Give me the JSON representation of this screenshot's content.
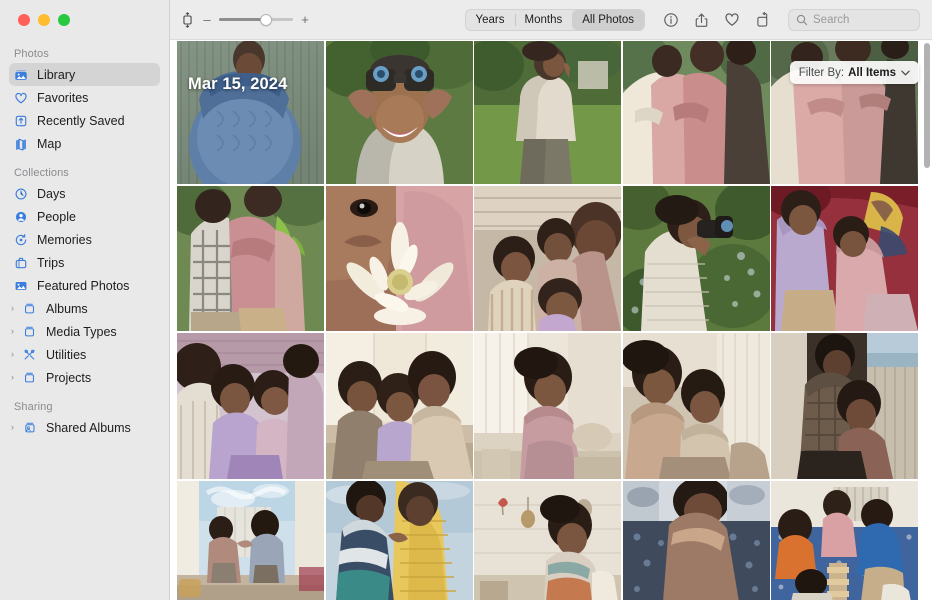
{
  "window": {
    "title": "Photos",
    "traffic_lights": {
      "close": "close",
      "minimize": "minimize",
      "zoom": "zoom"
    }
  },
  "toolbar": {
    "zoom_out_label": "–",
    "zoom_in_label": "+",
    "zoom_slider_value": 60,
    "view_modes": [
      {
        "label": "Years",
        "active": false
      },
      {
        "label": "Months",
        "active": false
      },
      {
        "label": "All Photos",
        "active": true
      }
    ],
    "icons": [
      {
        "name": "info-icon",
        "glyph": "info"
      },
      {
        "name": "share-icon",
        "glyph": "share"
      },
      {
        "name": "favorite-icon",
        "glyph": "heart"
      },
      {
        "name": "rotate-icon",
        "glyph": "rotate"
      }
    ],
    "search": {
      "placeholder": "Search",
      "value": ""
    }
  },
  "sidebar": {
    "sections": [
      {
        "title": "Photos",
        "items": [
          {
            "label": "Library",
            "icon": "library-icon",
            "selected": true,
            "expandable": false
          },
          {
            "label": "Favorites",
            "icon": "heart-icon",
            "selected": false,
            "expandable": false
          },
          {
            "label": "Recently Saved",
            "icon": "recently-saved-icon",
            "selected": false,
            "expandable": false
          },
          {
            "label": "Map",
            "icon": "map-icon",
            "selected": false,
            "expandable": false
          }
        ]
      },
      {
        "title": "Collections",
        "items": [
          {
            "label": "Days",
            "icon": "clock-icon",
            "selected": false,
            "expandable": false
          },
          {
            "label": "People",
            "icon": "person-icon",
            "selected": false,
            "expandable": false
          },
          {
            "label": "Memories",
            "icon": "memories-icon",
            "selected": false,
            "expandable": false
          },
          {
            "label": "Trips",
            "icon": "trips-icon",
            "selected": false,
            "expandable": false
          },
          {
            "label": "Featured Photos",
            "icon": "featured-photos-icon",
            "selected": false,
            "expandable": false
          },
          {
            "label": "Albums",
            "icon": "album-icon",
            "selected": false,
            "expandable": true
          },
          {
            "label": "Media Types",
            "icon": "album-icon",
            "selected": false,
            "expandable": true
          },
          {
            "label": "Utilities",
            "icon": "utilities-icon",
            "selected": false,
            "expandable": true
          },
          {
            "label": "Projects",
            "icon": "album-icon",
            "selected": false,
            "expandable": true
          }
        ]
      },
      {
        "title": "Sharing",
        "items": [
          {
            "label": "Shared Albums",
            "icon": "shared-album-icon",
            "selected": false,
            "expandable": true
          }
        ]
      }
    ],
    "disclosure_glyph": "›"
  },
  "content": {
    "date_label": "Mar 15, 2024",
    "filter": {
      "label": "Filter By:",
      "value": "All Items",
      "chevron": "⌄"
    },
    "grid": {
      "columns": 5,
      "rows": [
        {
          "row": 1,
          "cells": [
            {
              "alt": "Person in blue knit sweater against striped backdrop",
              "c1": "#5d7fa8",
              "c2": "#3f5f8a",
              "c3": "#7e9585",
              "c4": "#2b3a4d"
            },
            {
              "alt": "Smiling person looking through binoculars",
              "c1": "#8a6750",
              "c2": "#6d8a55",
              "c3": "#c9ad96",
              "c4": "#3c4a33"
            },
            {
              "alt": "Child in cream sweater standing on grass",
              "c1": "#9aa986",
              "c2": "#5b7442",
              "c3": "#ded6c6",
              "c4": "#7b8f63"
            },
            {
              "alt": "Two children in pink embracing outdoors",
              "c1": "#d9a7a4",
              "c2": "#b77b7c",
              "c3": "#8c6a62",
              "c4": "#e3c4bd"
            },
            {
              "alt": "Children hugging in pink sweatshirts",
              "c1": "#dba9a6",
              "c2": "#c08b88",
              "c3": "#6a7a5c",
              "c4": "#e8cdc6"
            }
          ]
        },
        {
          "row": 2,
          "cells": [
            {
              "alt": "Two children embracing wearing plaid and pink",
              "c1": "#9aab84",
              "c2": "#c98f92",
              "c3": "#d9d5cd",
              "c4": "#5c6f49"
            },
            {
              "alt": "Close-up of white dahlia flower held by person",
              "c1": "#c98f92",
              "c2": "#f0ead9",
              "c3": "#d7b9ae",
              "c4": "#b8a07f"
            },
            {
              "alt": "Family of five lying together smiling",
              "c1": "#b08d79",
              "c2": "#6d5244",
              "c3": "#d9c7b4",
              "c4": "#4b3a30"
            },
            {
              "alt": "Child using binoculars in a garden",
              "c1": "#7d9159",
              "c2": "#4d6236",
              "c3": "#cfd2c0",
              "c4": "#2f3d24"
            },
            {
              "alt": "Two children resting on a red velvet sofa",
              "c1": "#8e2733",
              "c2": "#b9a9cf",
              "c3": "#c7ad8a",
              "c4": "#6b1b24"
            }
          ]
        },
        {
          "row": 3,
          "cells": [
            {
              "alt": "Family cuddling on a bed in lavender clothing",
              "c1": "#c0a0b2",
              "c2": "#9a7f94",
              "c3": "#d8cfd6",
              "c4": "#7a6070"
            },
            {
              "alt": "Parent and children sitting in bright living room",
              "c1": "#d6c7b2",
              "c2": "#8e7a68",
              "c3": "#efe6d6",
              "c4": "#5d4d40"
            },
            {
              "alt": "Child on a bed in sunlit bedroom",
              "c1": "#e5ddd0",
              "c2": "#a08f7c",
              "c3": "#f2ece2",
              "c4": "#6e5f52"
            },
            {
              "alt": "Two siblings leaning together on sofa",
              "c1": "#c8a98f",
              "c2": "#8a6f5c",
              "c3": "#ded2c1",
              "c4": "#4f4036"
            },
            {
              "alt": "Adult embracing child by a window",
              "c1": "#3a3129",
              "c2": "#6d5c4c",
              "c3": "#b7a995",
              "c4": "#1f1a16"
            }
          ]
        },
        {
          "row": 4,
          "cells": [
            {
              "alt": "Two children playing clapping game by window",
              "c1": "#dfe3e6",
              "c2": "#9fa6ad",
              "c3": "#c3b4a4",
              "c4": "#6a7078"
            },
            {
              "alt": "Child and adult in yellow blanket close-up",
              "c1": "#e8c85c",
              "c2": "#3a4d66",
              "c3": "#cfd9dd",
              "c4": "#2a3646"
            },
            {
              "alt": "Child in striped shirt in a bedroom",
              "c1": "#d8cfc2",
              "c2": "#8f8374",
              "c3": "#efeae0",
              "c4": "#5a5047"
            },
            {
              "alt": "Child bending over patterned rug with toys",
              "c1": "#3f4a5c",
              "c2": "#d5dae0",
              "c3": "#8b96a4",
              "c4": "#232a36"
            },
            {
              "alt": "Family playing wooden block game on blue rug",
              "c1": "#4a6ea8",
              "c2": "#d9a15c",
              "c3": "#e4e0d6",
              "c4": "#2f4770"
            }
          ]
        }
      ]
    }
  }
}
